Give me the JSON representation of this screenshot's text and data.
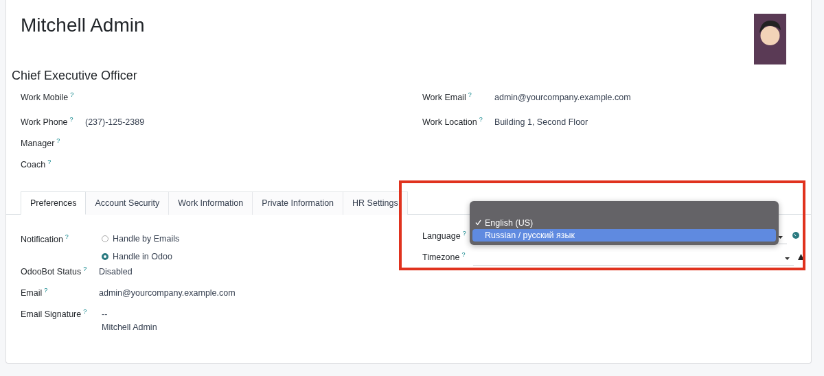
{
  "header": {
    "name": "Mitchell Admin",
    "job_title": "Chief Executive Officer"
  },
  "fields_left": [
    {
      "label": "Work Mobile",
      "help": "?"
    },
    {
      "label": "Work Phone",
      "help": "?",
      "value": "(237)-125-2389"
    },
    {
      "label": "Manager",
      "help": "?"
    },
    {
      "label": "Coach",
      "help": "?"
    }
  ],
  "fields_right": [
    {
      "label": "Work Email",
      "help": "?",
      "value": "admin@yourcompany.example.com"
    },
    {
      "label": "Work Location",
      "help": "?",
      "value": "Building 1, Second Floor"
    }
  ],
  "tabs": [
    {
      "label": "Preferences",
      "selected": true
    },
    {
      "label": "Account Security",
      "selected": false
    },
    {
      "label": "Work Information",
      "selected": false
    },
    {
      "label": "Private Information",
      "selected": false
    },
    {
      "label": "HR Settings",
      "selected": false
    }
  ],
  "preferences": {
    "notification": {
      "label": "Notification",
      "help": "?",
      "options": [
        {
          "label": "Handle by Emails",
          "selected": false
        },
        {
          "label": "Handle in Odoo",
          "selected": true
        }
      ]
    },
    "odoobot": {
      "label": "OdooBot Status",
      "help": "?",
      "value": "Disabled"
    },
    "email": {
      "label": "Email",
      "help": "?",
      "value": "admin@yourcompany.example.com"
    },
    "signature": {
      "label": "Email Signature",
      "help": "?",
      "lines": [
        "--",
        "Mitchell Admin"
      ]
    },
    "language": {
      "label": "Language",
      "help": "?"
    },
    "timezone": {
      "label": "Timezone",
      "help": "?"
    }
  },
  "language_menu": {
    "options": [
      {
        "label": "English (US)",
        "checked": true,
        "selected": false
      },
      {
        "label": "Russian / русский язык",
        "checked": false,
        "selected": true
      }
    ]
  }
}
